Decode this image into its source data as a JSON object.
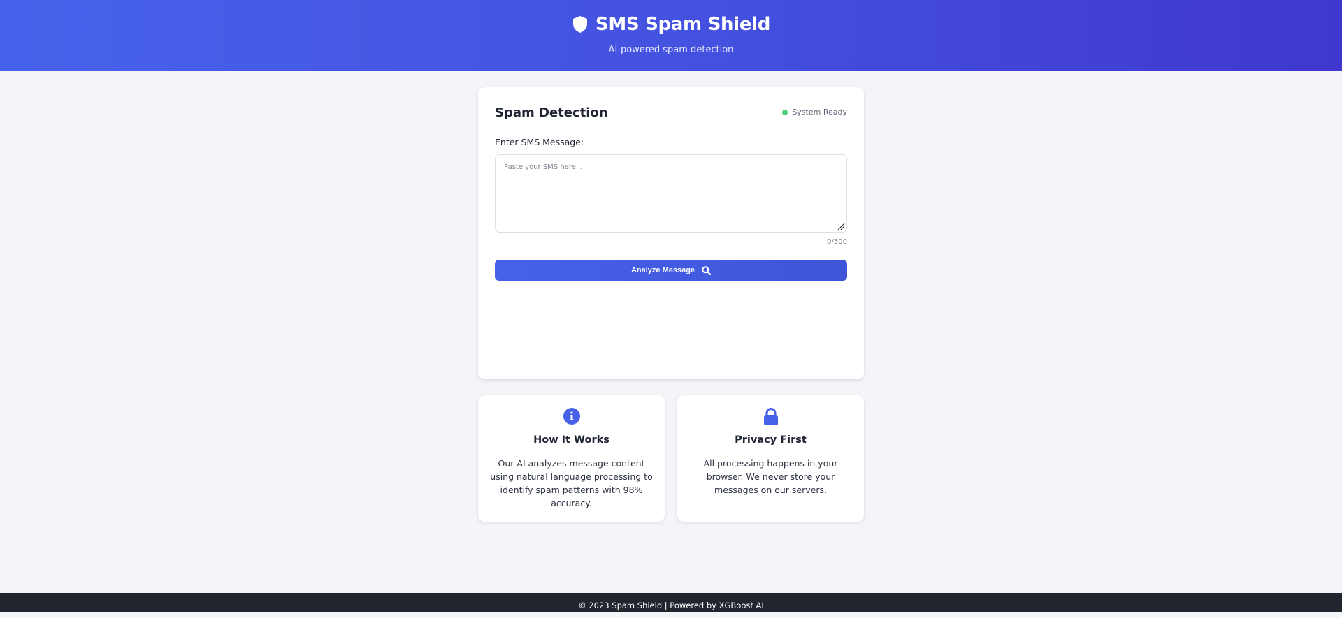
{
  "header": {
    "title": "SMS Spam Shield",
    "tagline": "AI-powered spam detection",
    "icon": "shield-icon"
  },
  "detection": {
    "title": "Spam Detection",
    "status_text": "System Ready",
    "status_color": "#4ad07a",
    "field_label": "Enter SMS Message:",
    "placeholder": "Paste your SMS here...",
    "value": "",
    "char_count": "0/500",
    "analyze_label": "Analyze Message",
    "analyze_icon": "search-icon"
  },
  "info_cards": [
    {
      "icon": "info-icon",
      "title": "How It Works",
      "text": "Our AI analyzes message content using natural language processing to identify spam patterns with 98% accuracy."
    },
    {
      "icon": "lock-icon",
      "title": "Privacy First",
      "text": "All processing happens in your browser. We never store your messages on our servers."
    }
  ],
  "footer": {
    "text": "© 2023 Spam Shield | Powered by XGBoost AI"
  },
  "colors": {
    "accent": "#4661e8",
    "header_gradient_start": "#4762ea",
    "header_gradient_end": "#4037cf",
    "footer_bg": "#21252d",
    "page_bg": "#f4f5f9"
  }
}
